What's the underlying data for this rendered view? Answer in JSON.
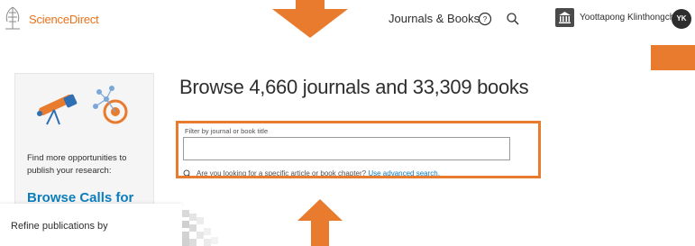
{
  "header": {
    "brand": "ScienceDirect",
    "nav_journals": "Journals & Books",
    "help_icon": "help-circle-icon",
    "search_icon": "search-icon",
    "institution_icon": "institution-icon",
    "username": "Yoottapong Klinthongchai",
    "avatar_initials": "YK"
  },
  "sidebar": {
    "promo_text": "Find more opportunities to publish your research:",
    "promo_link": "Browse Calls for"
  },
  "refine": {
    "label": "Refine publications by"
  },
  "main": {
    "title": "Browse 4,660 journals and 33,309 books",
    "filter_label": "Filter by journal or book title",
    "filter_value": "",
    "hint_prefix": "Are you looking for a specific article or book chapter?",
    "hint_link": "Use advanced search."
  },
  "colors": {
    "annotation_orange": "#e87b2d",
    "brand_orange": "#e9711c",
    "link_blue": "#0c7dbb"
  }
}
